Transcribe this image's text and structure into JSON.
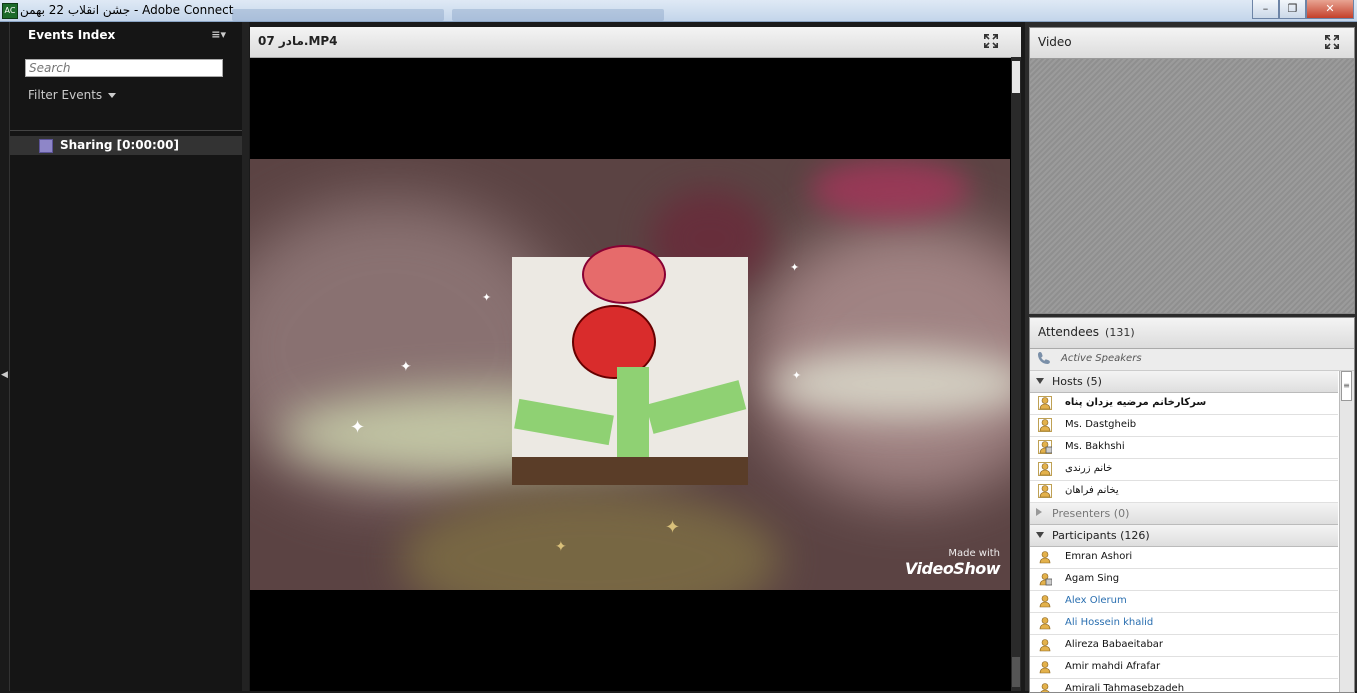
{
  "window": {
    "title": "جشن انقلاب 22 بهمن - Adobe Connect",
    "controls": [
      "minimize",
      "restore",
      "close"
    ]
  },
  "events": {
    "title": "Events Index",
    "menu_icon": "menu-icon",
    "search_placeholder": "Search",
    "filter_label": "Filter Events",
    "items": [
      {
        "label": "Sharing [0:00:00]",
        "icon": "sharing-layout-icon"
      }
    ]
  },
  "share_pod": {
    "title": "مادر 07.MP4",
    "watermark_small": "Made with",
    "watermark_big": "VideoShow"
  },
  "video_pod": {
    "title": "Video"
  },
  "attendees": {
    "title": "Attendees",
    "count": "(131)",
    "active_speakers_label": "Active Speakers",
    "groups": [
      {
        "label": "Hosts (5)",
        "expanded": true,
        "members": [
          {
            "name": "سرکارخانم مرضیه یزدان پناه",
            "style": "bold",
            "icon": "host-avatar-icon"
          },
          {
            "name": "Ms. Dastgheib",
            "style": "normal",
            "icon": "host-avatar-icon"
          },
          {
            "name": "Ms. Bakhshi",
            "style": "normal",
            "icon": "host-presenter-avatar-icon"
          },
          {
            "name": "خانم زرندی",
            "style": "normal",
            "icon": "host-avatar-icon"
          },
          {
            "name": "یخانم فراهان",
            "style": "normal",
            "icon": "host-avatar-icon"
          }
        ]
      },
      {
        "label": "Presenters (0)",
        "expanded": false,
        "members": []
      },
      {
        "label": "Participants (126)",
        "expanded": true,
        "members": [
          {
            "name": "Emran  Ashori",
            "style": "normal",
            "icon": "participant-avatar-icon"
          },
          {
            "name": "Agam Sing",
            "style": "normal",
            "icon": "participant-screen-avatar-icon"
          },
          {
            "name": "Alex Olerum",
            "style": "link",
            "icon": "participant-avatar-icon"
          },
          {
            "name": "Ali Hossein khalid",
            "style": "link",
            "icon": "participant-avatar-icon"
          },
          {
            "name": "Alireza Babaeitabar",
            "style": "normal",
            "icon": "participant-avatar-icon"
          },
          {
            "name": "Amir mahdi Afrafar",
            "style": "normal",
            "icon": "participant-avatar-icon"
          },
          {
            "name": "Amirali Tahmasebzadeh",
            "style": "normal",
            "icon": "participant-avatar-icon"
          }
        ]
      }
    ]
  },
  "colors": {
    "background": "#1a1a1a",
    "sidebar": "#151515",
    "link": "#2a6fb0",
    "avatar_gold": "#e3b14b"
  }
}
